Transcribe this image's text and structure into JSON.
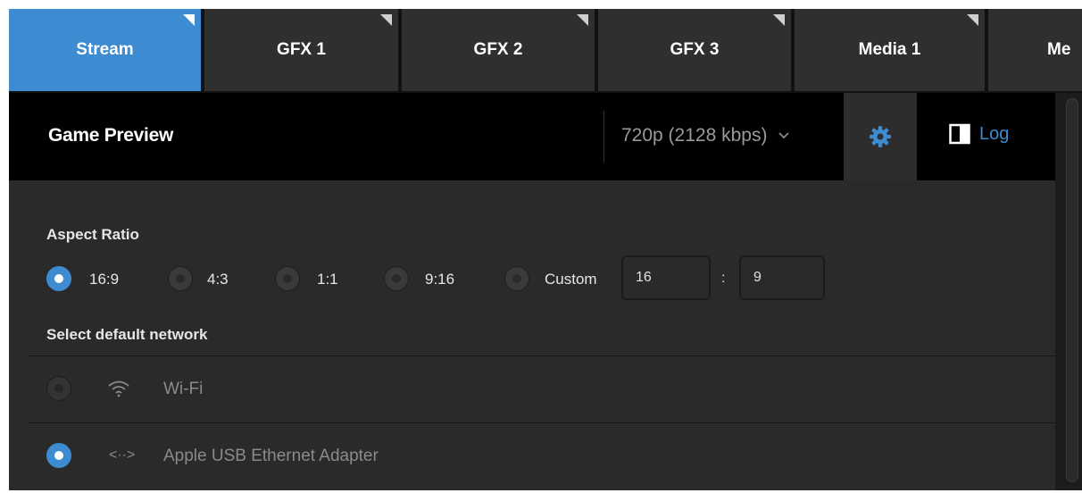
{
  "tabs": [
    {
      "label": "Stream",
      "active": true
    },
    {
      "label": "GFX 1",
      "active": false
    },
    {
      "label": "GFX 2",
      "active": false
    },
    {
      "label": "GFX 3",
      "active": false
    },
    {
      "label": "Media 1",
      "active": false
    },
    {
      "label": "Me",
      "active": false
    }
  ],
  "header": {
    "title": "Game Preview",
    "quality": "720p (2128 kbps)",
    "log_label": "Log"
  },
  "aspect_ratio": {
    "label": "Aspect Ratio",
    "options": [
      "16:9",
      "4:3",
      "1:1",
      "9:16",
      "Custom"
    ],
    "selected": "16:9",
    "custom_width": "16",
    "custom_separator": ":",
    "custom_height": "9"
  },
  "network": {
    "label": "Select default network",
    "options": [
      {
        "label": "Wi-Fi",
        "icon": "wifi-icon",
        "selected": false
      },
      {
        "label": "Apple USB Ethernet Adapter",
        "icon": "ethernet-icon",
        "icon_glyph": "<··>",
        "selected": true
      }
    ]
  },
  "colors": {
    "accent": "#3d8bd0",
    "tab_bg": "#2f2f2f",
    "header_bg": "#000000",
    "panel_bg": "#2a2a2a"
  }
}
